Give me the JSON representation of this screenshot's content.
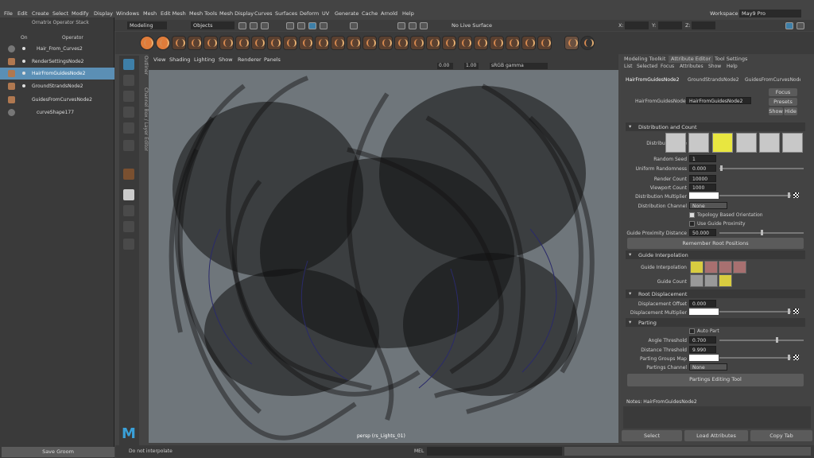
{
  "main_menu": [
    "File",
    "Edit",
    "Create",
    "Select",
    "Modify",
    "Display",
    "Windows",
    "Mesh",
    "Edit Mesh",
    "Mesh Tools",
    "Mesh Display",
    "Curves",
    "Surfaces",
    "Deform",
    "UV",
    "Generate",
    "Cache",
    "Arnold",
    "Help"
  ],
  "workspace": {
    "label": "Workspace :",
    "value": "May9 Pro"
  },
  "mode_menu": "Modeling",
  "objects_field": "Objects",
  "live_surface": "No Live Surface",
  "coords": {
    "x": "X:",
    "y": "Y:",
    "z": "Z:"
  },
  "outliner": {
    "title": "Ornatrix Operator Stack",
    "col_on": "On",
    "col_operator": "Operator",
    "rows": [
      "Hair_From_Curves2",
      "RenderSettingsNode2",
      "HairFromGuidesNode2",
      "GroundStrandsNode2",
      "GuidesFromCurvesNode2",
      "curveShape177"
    ],
    "selected_index": 2,
    "save_groom": "Save Groom"
  },
  "side_tabs": {
    "outliner": "Outliner",
    "channel_box": "Channel Box / Layer Editor"
  },
  "viewport": {
    "menus": [
      "View",
      "Shading",
      "Lighting",
      "Show",
      "Renderer",
      "Panels"
    ],
    "field_a": "0.00",
    "field_b": "1.00",
    "color_space": "sRGB gamma",
    "camera_label": "persp (rs_Lights_01)"
  },
  "right_tabs": [
    "Modeling Toolkit",
    "Attribute Editor",
    "Tool Settings"
  ],
  "attr_menu": [
    "List",
    "Selected",
    "Focus",
    "Attributes",
    "Show",
    "Help"
  ],
  "node_tabs": [
    "HairFromGuidesNode2",
    "GroundStrandsNode2",
    "GuidesFromCurvesNode2"
  ],
  "node_label": "HairFromGuidesNode:",
  "node_value": "HairFromGuidesNode2",
  "buttons": {
    "focus": "Focus",
    "presets": "Presets",
    "show": "Show",
    "hide": "Hide"
  },
  "sections": {
    "distribution": "Distribution and Count",
    "guide_interp": "Guide Interpolation",
    "root_disp": "Root Displacement",
    "parting": "Parting"
  },
  "distribution": {
    "type_label": "Distribution Type",
    "random_seed_label": "Random Seed",
    "random_seed": "1",
    "uniform_label": "Uniform Randomness",
    "uniform": "0.000",
    "render_count_label": "Render Count",
    "render_count": "10000",
    "viewport_count_label": "Viewport Count",
    "viewport_count": "1000",
    "multiplier_label": "Distribution Multiplier",
    "channel_label": "Distribution Channel",
    "channel": "None",
    "topology_label": "Topology Based Orientation",
    "guide_prox_label": "Use Guide Proximity",
    "prox_dist_label": "Guide Proximity Distance",
    "prox_dist": "50.000",
    "remember_btn": "Remember Root Positions"
  },
  "guide_interp": {
    "interp_label": "Guide Interpolation",
    "count_label": "Guide Count"
  },
  "root_disp": {
    "offset_label": "Displacement Offset",
    "offset": "0.000",
    "multiplier_label": "Displacement Multiplier"
  },
  "parting": {
    "auto_label": "Auto Part",
    "angle_label": "Angle Threshold",
    "angle": "0.700",
    "distance_label": "Distance Threshold",
    "distance": "9.990",
    "map_label": "Parting Groups Map",
    "channel_label": "Partings Channel",
    "channel": "None",
    "edit_btn": "Partings Editing Tool"
  },
  "notes": "Notes:  HairFromGuidesNode2",
  "bottom_buttons": [
    "Select",
    "Load Attributes",
    "Copy Tab"
  ],
  "status_msg": "Do not interpolate",
  "mel": "MEL"
}
